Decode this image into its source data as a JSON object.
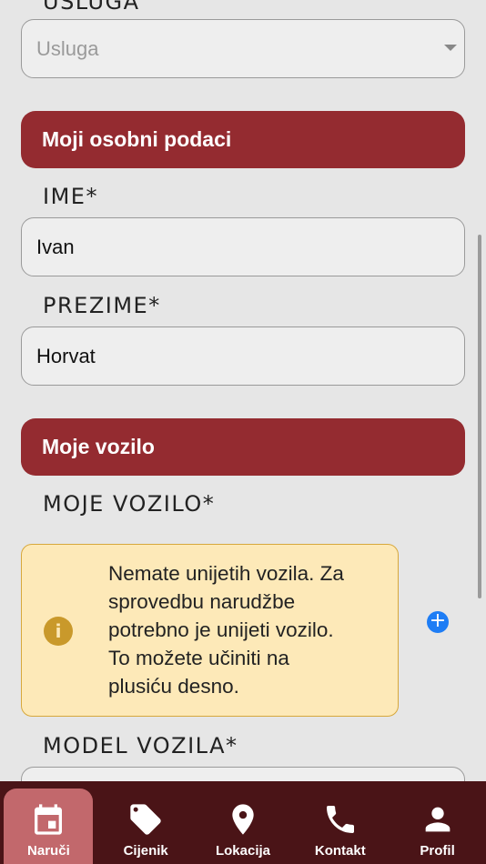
{
  "service": {
    "label": "USLUGA",
    "placeholder": "Usluga"
  },
  "section_personal": {
    "title": "Moji osobni podaci"
  },
  "first_name": {
    "label": "IME*",
    "value": "Ivan"
  },
  "last_name": {
    "label": "PREZIME*",
    "value": "Horvat"
  },
  "section_vehicle": {
    "title": "Moje vozilo"
  },
  "vehicle": {
    "label": "MOJE VOZILO*",
    "notice_lines": [
      "Nemate unijetih vozila. Za",
      "sprovedbu narudžbe",
      "potrebno je unijeti vozilo.",
      "To možete učiniti na",
      "plusiću desno."
    ],
    "info_icon": "i"
  },
  "model": {
    "label": "MODEL VOZILA*"
  },
  "nav": {
    "items": [
      {
        "label": "Naruči",
        "icon": "calendar-icon"
      },
      {
        "label": "Cijenik",
        "icon": "tag-icon"
      },
      {
        "label": "Lokacija",
        "icon": "location-pin-icon"
      },
      {
        "label": "Kontakt",
        "icon": "phone-icon"
      },
      {
        "label": "Profil",
        "icon": "person-icon"
      }
    ]
  },
  "colors": {
    "accent": "#942b30",
    "nav_bg": "#4a1417",
    "nav_active": "#c2686c",
    "notice_bg": "#fde9b8",
    "plus": "#1e7df5"
  }
}
